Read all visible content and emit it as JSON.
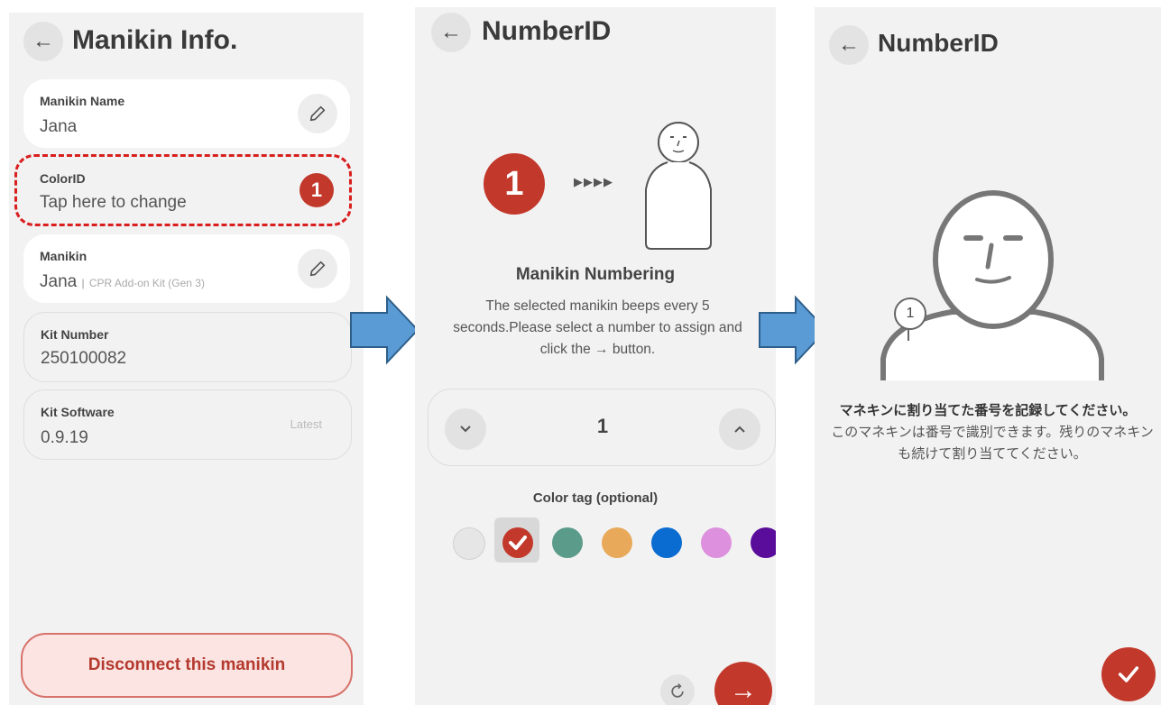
{
  "panel1": {
    "title": "Manikin Info.",
    "manikin_name": {
      "label": "Manikin Name",
      "value": "Jana"
    },
    "color_id": {
      "label": "ColorID",
      "value": "Tap here to change",
      "badge": "1"
    },
    "manikin": {
      "label": "Manikin",
      "value": "Jana",
      "sub": "CPR Add-on Kit (Gen 3)"
    },
    "kit_number": {
      "label": "Kit Number",
      "value": "250100082"
    },
    "kit_software": {
      "label": "Kit Software",
      "value": "0.9.19",
      "status": "Latest"
    },
    "disconnect_label": "Disconnect this manikin"
  },
  "panel2": {
    "title": "NumberID",
    "badge": "1",
    "arrows": "▶▶▶▶",
    "section_title": "Manikin Numbering",
    "description": "The selected manikin beeps every 5 seconds.Please select a number to assign and click the → button.",
    "stepper_value": "1",
    "color_tag_label": "Color tag (optional)",
    "color_tags": [
      "#e6e6e6",
      "#c2392b",
      "#5b9b8a",
      "#e8a95a",
      "#0a6bd0",
      "#dd90dd",
      "#5a0d9a"
    ]
  },
  "panel3": {
    "title": "NumberID",
    "figure_number": "1",
    "message_bold": "マネキンに割り当てた番号を記録してください。",
    "message": "このマネキンは番号で識別できます。残りのマネキンも続けて割り当ててください。"
  },
  "colors": {
    "accent": "#c2392b",
    "arrow_fill": "#5b9bd5",
    "arrow_stroke": "#2e5f8a"
  }
}
